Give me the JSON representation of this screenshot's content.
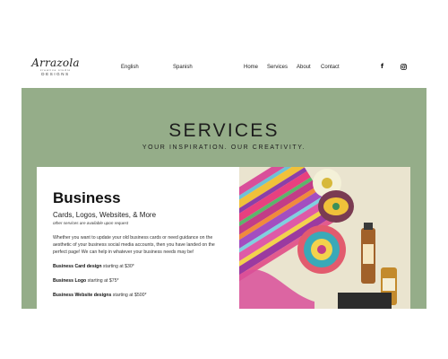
{
  "logo": {
    "script": "Arrazola",
    "sub": "creative studio",
    "designs": "DESIGNS"
  },
  "languages": [
    "English",
    "Spanish"
  ],
  "nav": {
    "home": "Home",
    "services": "Services",
    "about": "About",
    "contact": "Contact"
  },
  "social": {
    "facebook": "f"
  },
  "hero": {
    "title": "SERVICES",
    "subtitle": "YOUR INSPIRATION. OUR CREATIVITY."
  },
  "card": {
    "title": "Business",
    "subtitle": "Cards, Logos, Websites, & More",
    "note": "other services are available upon request",
    "body": "Whether you want to update your old business cards or need guidance on the aesthetic of your business social media accounts, then you have landed on the perfect page! We can help in whatever your business needs may be!",
    "prices": [
      {
        "label": "Business Card design",
        "text": " starting at $30*"
      },
      {
        "label": "Business Logo",
        "text": " starting at $75*"
      },
      {
        "label": "Business Website designs",
        "text": " starting at $500*"
      }
    ]
  },
  "colors": {
    "band": "#95ad89",
    "text": "#111111"
  }
}
